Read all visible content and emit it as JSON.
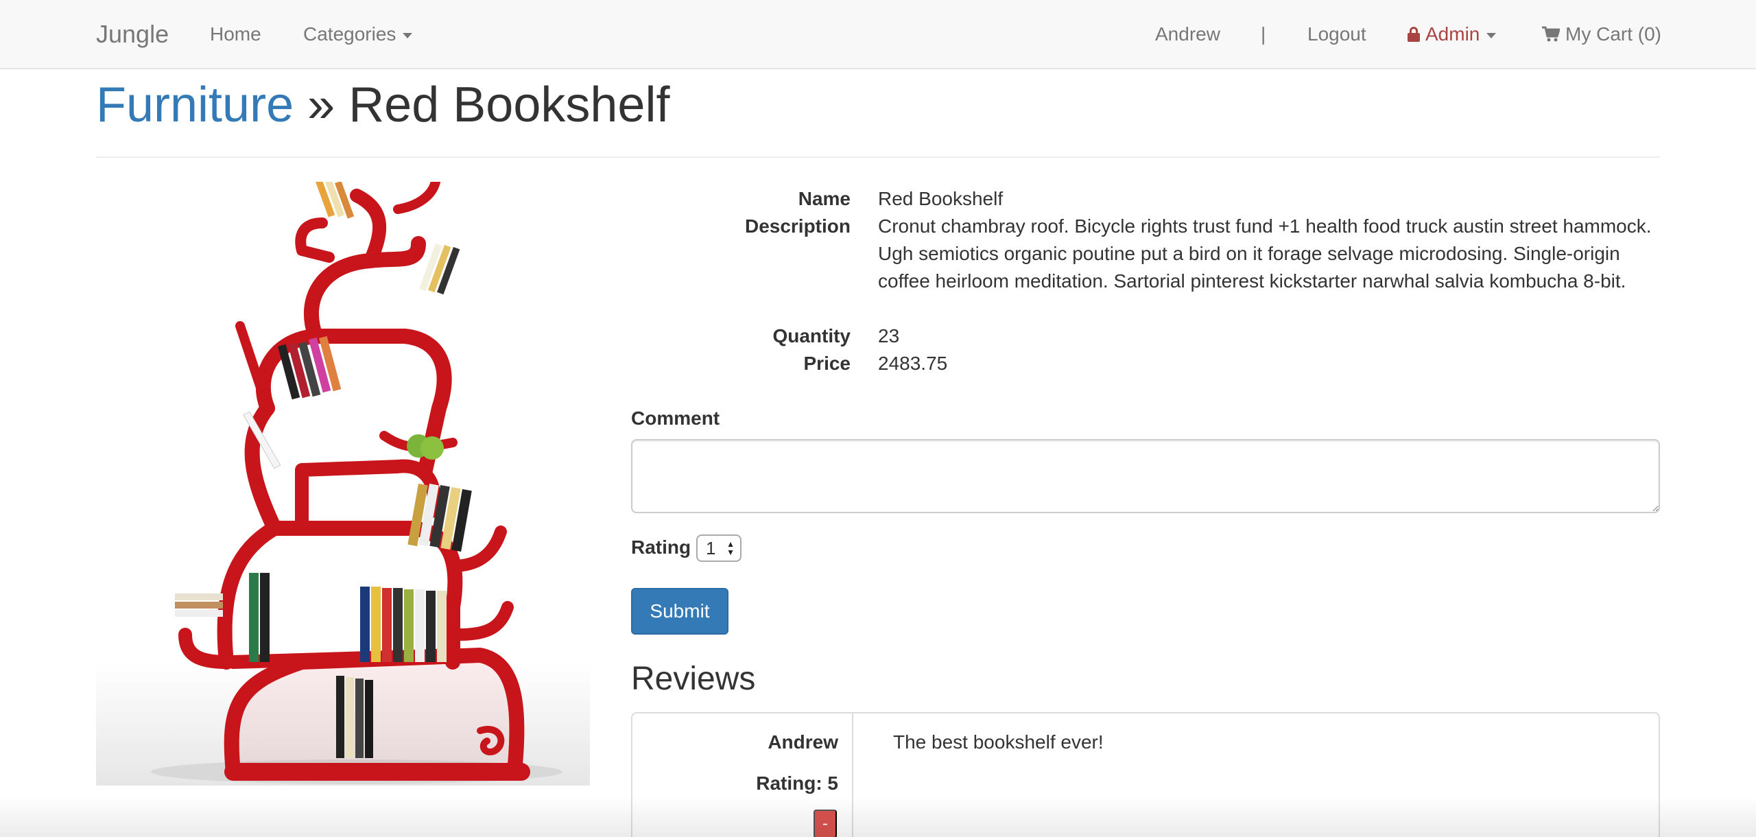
{
  "nav": {
    "brand": "Jungle",
    "home": "Home",
    "categories": "Categories",
    "user": "Andrew",
    "separator": "|",
    "logout": "Logout",
    "admin": "Admin",
    "cart": "My Cart (0)"
  },
  "header": {
    "category": "Furniture",
    "separator": "»",
    "product": "Red Bookshelf"
  },
  "details": {
    "name_label": "Name",
    "name": "Red Bookshelf",
    "description_label": "Description",
    "description": "Cronut chambray roof. Bicycle rights trust fund +1 health food truck austin street hammock. Ugh semiotics organic poutine put a bird on it forage selvage microdosing. Single-origin coffee heirloom meditation. Sartorial pinterest kickstarter narwhal salvia kombucha 8-bit.",
    "quantity_label": "Quantity",
    "quantity": "23",
    "price_label": "Price",
    "price": "2483.75"
  },
  "form": {
    "comment_label": "Comment",
    "comment_value": "",
    "rating_label": "Rating",
    "rating_value": "1",
    "submit_label": "Submit"
  },
  "reviews": {
    "title": "Reviews",
    "items": [
      {
        "author": "Andrew",
        "rating": "Rating: 5",
        "text": "The best bookshelf ever!",
        "delete_label": "-"
      }
    ]
  },
  "colors": {
    "link": "#337ab7",
    "admin": "#a94442",
    "primary_button": "#337ab7",
    "danger_button": "#d9534f",
    "bookshelf": "#c8151b"
  },
  "icons": [
    "lock-icon",
    "cart-icon",
    "caret-down-icon"
  ]
}
